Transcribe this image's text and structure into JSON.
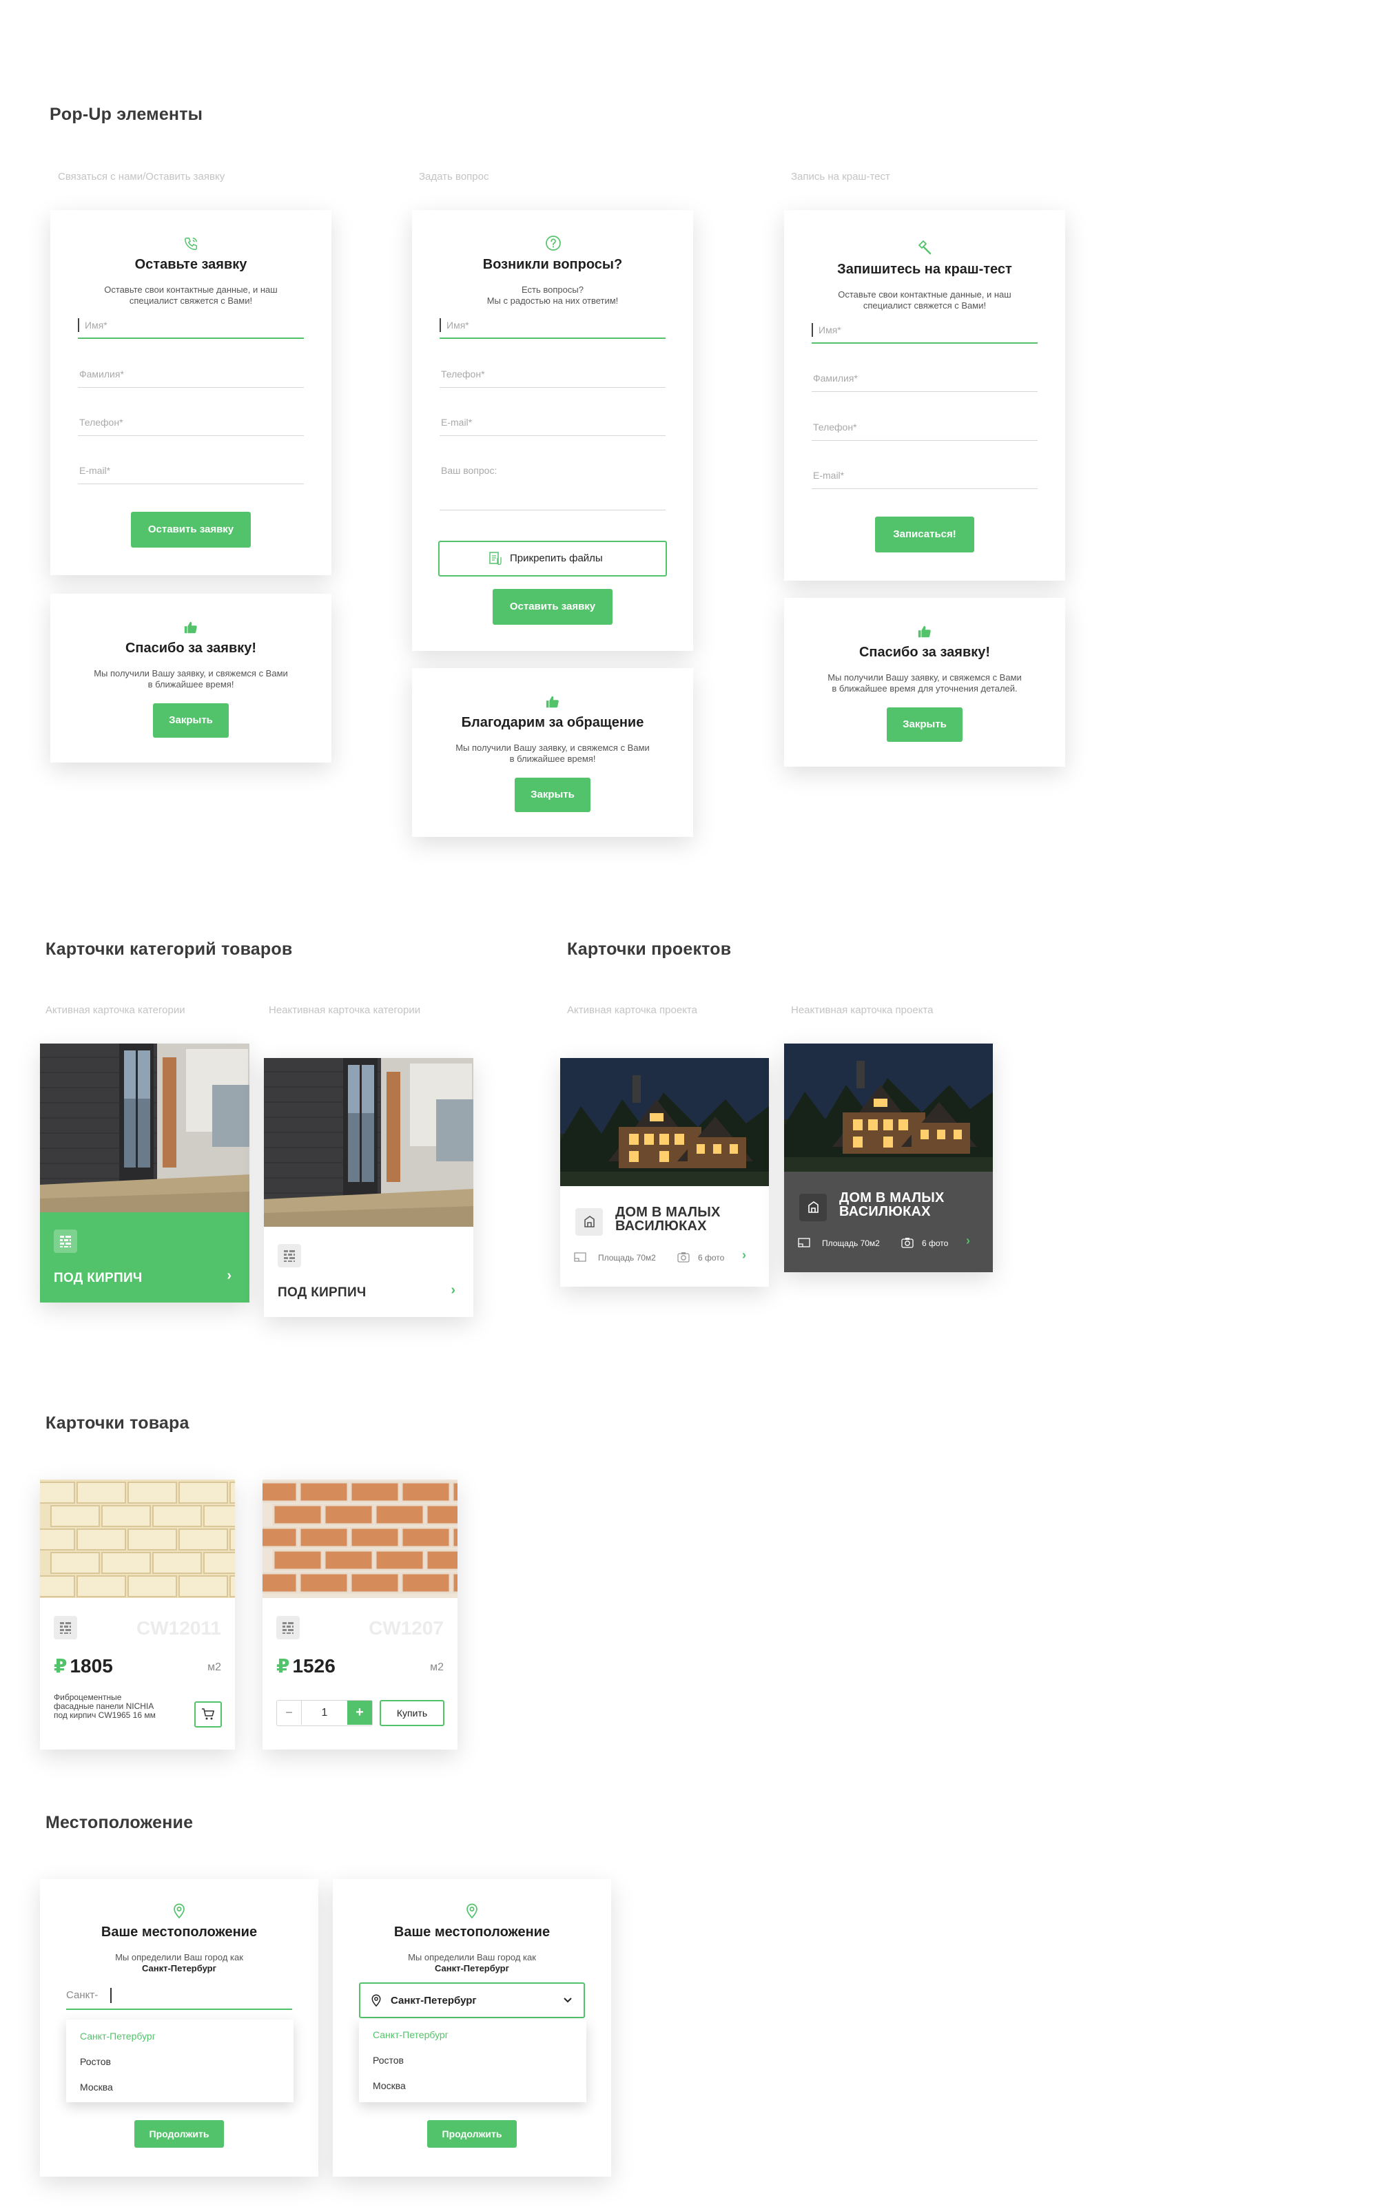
{
  "colors": {
    "accent": "#52c36a",
    "dark_card": "#505050",
    "text": "#222222",
    "muted": "#c4c4c4"
  },
  "popups": {
    "title": "Pop-Up элементы",
    "captions": [
      "Связаться с нами/Оставить заявку",
      "Задать вопрос",
      "Запись на краш-тест"
    ],
    "contact": {
      "icon": "phone-icon",
      "title": "Оставьте заявку",
      "subtitle_1": "Оставьте свои контактные данные, и наш",
      "subtitle_2": "специалист свяжется с Вами!",
      "fields": [
        "Имя*",
        "Фамилия*",
        "Телефон*",
        "E-mail*"
      ],
      "button": "Оставить заявку"
    },
    "question": {
      "icon": "question-icon",
      "title": "Возникли вопросы?",
      "subtitle_1": "Есть вопросы?",
      "subtitle_2": "Мы с радостью на них ответим!",
      "fields": [
        "Имя*",
        "Телефон*",
        "E-mail*",
        "Ваш вопрос:"
      ],
      "attach": "Прикрепить файлы",
      "button": "Оставить заявку"
    },
    "crash": {
      "icon": "hammer-icon",
      "title": "Запишитесь на краш-тест",
      "subtitle_1": "Оставьте свои контактные данные, и наш",
      "subtitle_2": "специалист свяжется с Вами!",
      "fields": [
        "Имя*",
        "Фамилия*",
        "Телефон*",
        "E-mail*"
      ],
      "button": "Записаться!"
    },
    "thanks_1": {
      "icon": "thumbs-up-icon",
      "title": "Спасибо за заявку!",
      "text_1": "Мы получили Вашу заявку, и свяжемся с Вами",
      "text_2": "в ближайшее время!",
      "button": "Закрыть"
    },
    "thanks_2": {
      "icon": "thumbs-up-icon",
      "title": "Благодарим за обращение",
      "text_1": "Мы получили Вашу заявку, и свяжемся с Вами",
      "text_2": "в ближайшее время!",
      "button": "Закрыть"
    },
    "thanks_3": {
      "icon": "thumbs-up-icon",
      "title": "Спасибо за заявку!",
      "text_1": "Мы получили Вашу заявку, и свяжемся с Вами",
      "text_2": "в ближайшее время для уточнения деталей.",
      "button": "Закрыть"
    }
  },
  "categories": {
    "title": "Карточки категорий товаров",
    "captions": [
      "Активная карточка категории",
      "Неактивная карточка категории"
    ],
    "active": {
      "name": "ПОД КИРПИЧ",
      "icon": "brick-pattern-icon"
    },
    "inactive": {
      "name": "ПОД КИРПИЧ",
      "icon": "brick-pattern-icon"
    }
  },
  "projects": {
    "title": "Карточки  проектов",
    "captions": [
      "Активная карточка проекта",
      "Неактивная карточка проекта"
    ],
    "active": {
      "title_1": "ДОМ В МАЛЫХ",
      "title_2": "ВАСИЛЮКАХ",
      "area": "Площадь 70м2",
      "photos": "6 фото"
    },
    "inactive": {
      "title_1": "ДОМ В МАЛЫХ",
      "title_2": "ВАСИЛЮКАХ",
      "area": "Площадь 70м2",
      "photos": "6 фото"
    }
  },
  "products": {
    "title": "Карточки товара",
    "items": [
      {
        "sku": "CW12011",
        "currency": "₽",
        "price": "1805",
        "unit": "м2",
        "description_1": "Фиброцементные",
        "description_2": "фасадные панели NICHIA",
        "description_3": "под кирпич CW1965 16 мм"
      },
      {
        "sku": "CW1207",
        "currency": "₽",
        "price": "1526",
        "unit": "м2",
        "qty_minus": "−",
        "qty": "1",
        "qty_plus": "+",
        "buy": "Купить"
      }
    ]
  },
  "location": {
    "title": "Местоположение",
    "cards": [
      {
        "title": "Ваше местоположение",
        "text_1": "Мы определили Ваш город как",
        "city": "Санкт-Петербург",
        "input_value": "Санкт-",
        "options": [
          "Санкт-Петербург",
          "Ростов",
          "Москва"
        ],
        "button": "Продолжить"
      },
      {
        "title": "Ваше местоположение",
        "text_1": "Мы определили Ваш город как",
        "city": "Санкт-Петербург",
        "select_value": "Санкт-Петербург",
        "options": [
          "Санкт-Петербург",
          "Ростов",
          "Москва"
        ],
        "button": "Продолжить"
      }
    ]
  }
}
